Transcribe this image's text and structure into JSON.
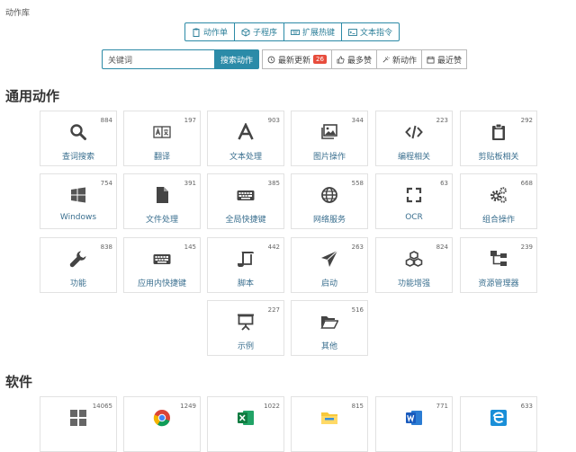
{
  "breadcrumb": "动作库",
  "tabs": [
    {
      "label": "动作单",
      "icon": "clipboard-icon"
    },
    {
      "label": "子程序",
      "icon": "cube-icon"
    },
    {
      "label": "扩展热键",
      "icon": "keyboard-icon"
    },
    {
      "label": "文本指令",
      "icon": "terminal-icon"
    }
  ],
  "search": {
    "value": "关键词",
    "button": "搜索动作"
  },
  "sort": [
    {
      "label": "最新更新",
      "badge": "26",
      "icon": "history-icon"
    },
    {
      "label": "最多赞",
      "icon": "thumbs-up-icon"
    },
    {
      "label": "新动作",
      "icon": "new-icon"
    },
    {
      "label": "最近赞",
      "icon": "calendar-icon"
    }
  ],
  "sections": {
    "common": "通用动作",
    "software": "软件"
  },
  "common_actions": [
    {
      "label": "查词搜索",
      "count": "884",
      "icon": "search-icon"
    },
    {
      "label": "翻译",
      "count": "197",
      "icon": "translate-icon"
    },
    {
      "label": "文本处理",
      "count": "903",
      "icon": "font-icon"
    },
    {
      "label": "图片操作",
      "count": "344",
      "icon": "image-icon"
    },
    {
      "label": "编程相关",
      "count": "223",
      "icon": "code-icon"
    },
    {
      "label": "剪贴板相关",
      "count": "292",
      "icon": "clipboard-icon"
    },
    {
      "label": "Windows",
      "count": "754",
      "icon": "windows-icon"
    },
    {
      "label": "文件处理",
      "count": "391",
      "icon": "file-icon"
    },
    {
      "label": "全局快捷键",
      "count": "385",
      "icon": "keyboard-icon"
    },
    {
      "label": "网络服务",
      "count": "558",
      "icon": "globe-icon"
    },
    {
      "label": "OCR",
      "count": "63",
      "icon": "ocr-icon"
    },
    {
      "label": "组合操作",
      "count": "668",
      "icon": "gears-icon"
    },
    {
      "label": "功能",
      "count": "838",
      "icon": "wrench-icon"
    },
    {
      "label": "应用内快捷键",
      "count": "145",
      "icon": "keyboard-icon"
    },
    {
      "label": "脚本",
      "count": "442",
      "icon": "scroll-icon"
    },
    {
      "label": "启动",
      "count": "263",
      "icon": "paper-plane-icon"
    },
    {
      "label": "功能增强",
      "count": "824",
      "icon": "cubes-icon"
    },
    {
      "label": "资源管理器",
      "count": "239",
      "icon": "sitemap-icon"
    },
    {
      "label": "示例",
      "count": "227",
      "icon": "presentation-icon"
    },
    {
      "label": "其他",
      "count": "516",
      "icon": "folder-open-icon"
    }
  ],
  "software": [
    {
      "label": "",
      "count": "14065",
      "icon": "app-grid-icon"
    },
    {
      "label": "",
      "count": "1249",
      "icon": "chrome-icon"
    },
    {
      "label": "",
      "count": "1022",
      "icon": "excel-icon"
    },
    {
      "label": "",
      "count": "815",
      "icon": "explorer-icon"
    },
    {
      "label": "",
      "count": "771",
      "icon": "word-icon"
    },
    {
      "label": "",
      "count": "633",
      "icon": "edge-icon"
    }
  ],
  "colors": {
    "accent": "#2b8ba8",
    "icon": "#444444",
    "label": "#3a6f8f",
    "badge": "#e74c3c"
  }
}
